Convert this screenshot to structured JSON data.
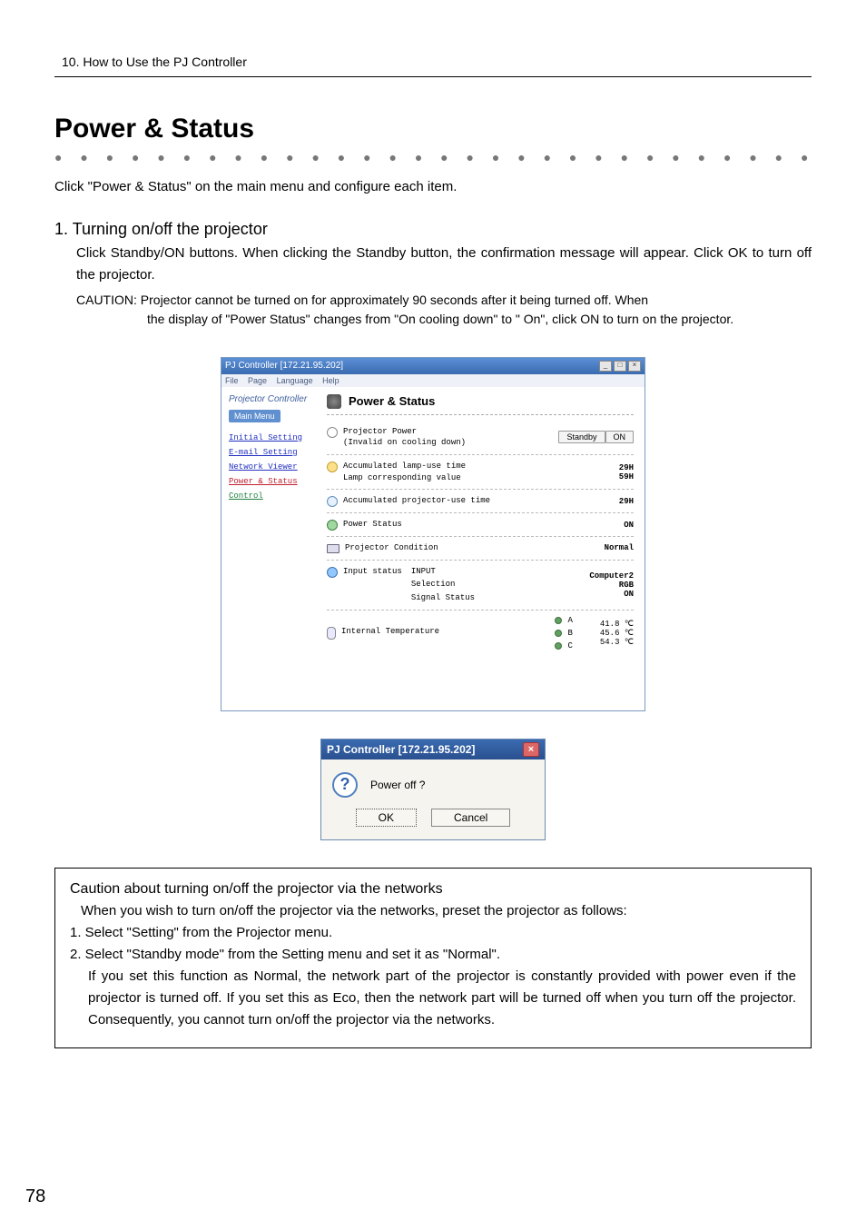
{
  "header": {
    "line": "10. How to Use the PJ Controller"
  },
  "title": "Power & Status",
  "intro": "Click \"Power & Status\" on the main menu and configure each item.",
  "section1": {
    "heading": "1. Turning on/off the projector",
    "body": "Click Standby/ON buttons. When clicking the Standby button, the confirmation message will appear. Click OK to turn off the projector.",
    "caution_lead": "CAUTION: Projector cannot be turned on for approximately 90 seconds after it being turned off.  When",
    "caution_rest": "the display of \"Power Status\" changes from \"On cooling down\" to \" On\", click ON to turn on the projector."
  },
  "app": {
    "title": "PJ Controller [172.21.95.202]",
    "menu": {
      "file": "File",
      "page": "Page",
      "language": "Language",
      "help": "Help"
    },
    "brand": "Projector Controller",
    "mainmenu": "Main Menu",
    "nav": {
      "initial": "Initial Setting",
      "email": "E-mail Setting",
      "viewer": "Network Viewer",
      "power": "Power & Status",
      "control": "Control"
    },
    "content_title": "Power & Status",
    "rows": {
      "power": {
        "l1": "Projector Power",
        "l2": "(Invalid on cooling down)",
        "btn_standby": "Standby",
        "btn_on": "ON"
      },
      "lamp": {
        "l1": "Accumulated lamp-use time",
        "l2": "Lamp corresponding value",
        "v1": "29H",
        "v2": "59H"
      },
      "proj": {
        "l1": "Accumulated projector-use time",
        "v1": "29H"
      },
      "pstat": {
        "l1": "Power Status",
        "v1": "ON"
      },
      "cond": {
        "l1": "Projector Condition",
        "v1": "Normal"
      },
      "input": {
        "l0": "Input status",
        "l1": "INPUT",
        "l2": "Selection",
        "l3": "Signal Status",
        "v1": "Computer2",
        "v2": "RGB",
        "v3": "ON"
      },
      "temp": {
        "l1": "Internal Temperature",
        "a_lbl": "A",
        "b_lbl": "B",
        "c_lbl": "C",
        "a": "41.8 ℃",
        "b": "45.6 ℃",
        "c": "54.3 ℃"
      }
    }
  },
  "dialog": {
    "title": "PJ Controller [172.21.95.202]",
    "message": "Power off ?",
    "ok": "OK",
    "cancel": "Cancel"
  },
  "cautionbox": {
    "heading": "Caution about turning on/off the projector via the networks",
    "lead": "When you wish to turn on/off the projector via the networks, preset the projector as follows:",
    "item1": "1. Select \"Setting\" from the Projector menu.",
    "item2": "2. Select \"Standby mode\" from the Setting menu and set it as \"Normal\".",
    "item2body": "If you set this function as Normal, the network part of the projector is constantly provided with power even if the projector is turned off. If you set this as Eco, then the network part will be turned off when you turn off the projector. Consequently, you cannot turn on/off the projector via the networks."
  },
  "pagenum": "78"
}
